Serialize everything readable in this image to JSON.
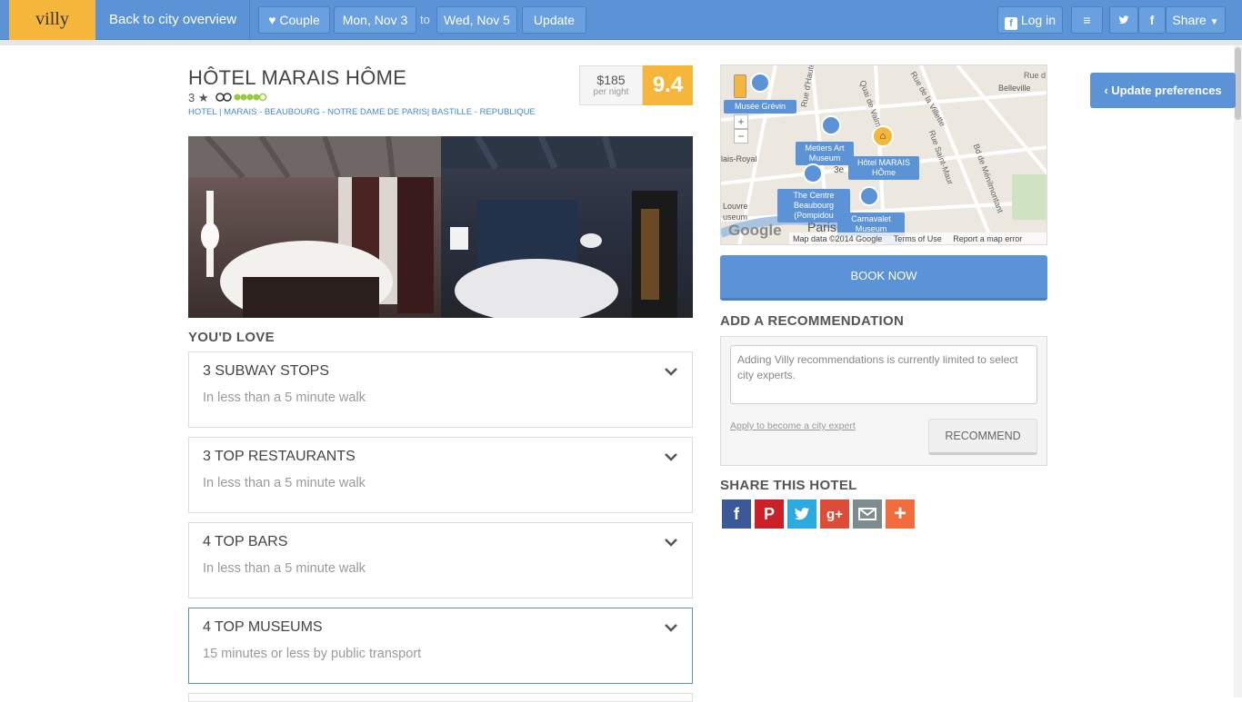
{
  "topbar": {
    "logo": "villy",
    "back_label": "Back to city overview",
    "couple_label": "Couple",
    "checkin": "Mon, Nov 3",
    "to_label": "to",
    "checkout": "Wed, Nov 5",
    "update_label": "Update",
    "login_label": "Log in",
    "share_label": "Share"
  },
  "hotel": {
    "title": "HÔTEL MARAIS HÔME",
    "stars": "3 ★",
    "breadcrumbs": "HOTEL | MARAIS - BEAUBOURG - NOTRE DAME DE PARIS| BASTILLE - REPUBLIQUE",
    "price": "$185",
    "price_sub": "per night",
    "score": "9.4"
  },
  "love_heading": "YOU'D LOVE",
  "features": [
    {
      "title": "3 SUBWAY STOPS",
      "sub": "In less than a 5 minute walk"
    },
    {
      "title": "3 TOP RESTAURANTS",
      "sub": "In less than a 5 minute walk"
    },
    {
      "title": "4 TOP BARS",
      "sub": "In less than a 5 minute walk"
    },
    {
      "title": "4 TOP MUSEUMS",
      "sub": "15 minutes or less by public transport"
    }
  ],
  "map": {
    "labels": {
      "grevin": "Musée Grévin",
      "metiers": "Metiers Art Museum",
      "hotel": "Hôtel MARAIS HÔme",
      "centre": "The Centre Beaubourg (Pompidou",
      "carnavalet": "Carnavalet Museum"
    },
    "streets": {
      "dhauteville": "Rue d'Hauteville",
      "valmy": "Quai de Valmy",
      "villette": "Rue de la Villette",
      "belleville": "Belleville",
      "saintmaur": "Rue Saint-Maur",
      "menilmontant": "Bd de Ménilmontant",
      "palais": "lais-Royal",
      "third": "3e",
      "louvre": "Louvre",
      "useum": "useum",
      "paris": "Paris",
      "rue": "Rue d"
    },
    "footer": "Map data ©2014 Google",
    "terms": "Terms of Use",
    "report": "Report a map error",
    "google": "Google"
  },
  "book_now": "BOOK NOW",
  "recommend": {
    "heading": "ADD A RECOMMENDATION",
    "placeholder": "Adding Villy recommendations is currently limited to select city experts.",
    "apply_link": "Apply to become a city expert",
    "button": "RECOMMEND"
  },
  "share_heading": "SHARE THIS HOTEL",
  "update_pref": "Update preferences",
  "colors": {
    "primary": "#5b93d6",
    "accent": "#f5b63b"
  }
}
